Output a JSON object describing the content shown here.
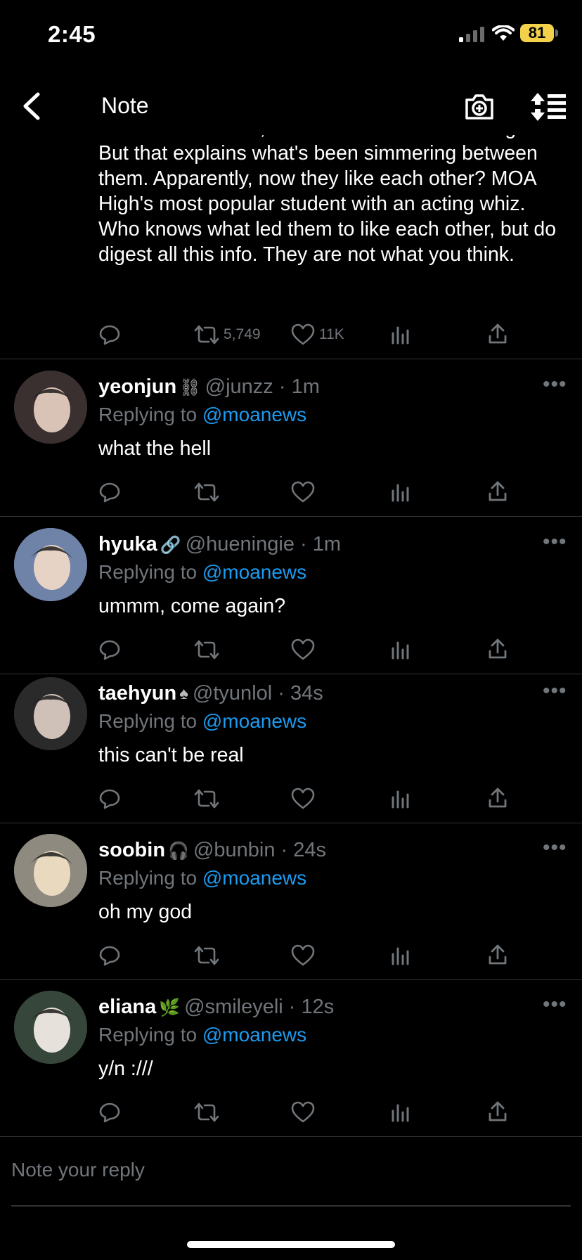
{
  "status": {
    "time": "2:45",
    "battery": "81"
  },
  "nav": {
    "title": "Note"
  },
  "main_tweet": {
    "text": "about this incident, and who wouldn't? This is gold! But that explains what's been simmering between them. Apparently, now they like each other? MOA High's most popular student with an acting whiz. Who knows what led them to like each other, but do digest all this info. They are not what you think.",
    "retweets": "5,749",
    "likes": "11K"
  },
  "replies": [
    {
      "name": "yeonjun",
      "badge": "⛓",
      "handle": "@junzz",
      "time": "1m",
      "replying_label": "Replying to",
      "replying_to": "@moanews",
      "text": "what the hell"
    },
    {
      "name": "hyuka",
      "badge": "🔗",
      "handle": "@hueningie",
      "time": "1m",
      "replying_label": "Replying to",
      "replying_to": "@moanews",
      "text": "ummm, come again?"
    },
    {
      "name": "taehyun",
      "badge": "♠",
      "handle": "@tyunlol",
      "time": "34s",
      "replying_label": "Replying to",
      "replying_to": "@moanews",
      "text": "this can't be real"
    },
    {
      "name": "soobin",
      "badge": "🎧",
      "handle": "@bunbin",
      "time": "24s",
      "replying_label": "Replying to",
      "replying_to": "@moanews",
      "text": "oh my god"
    },
    {
      "name": "eliana",
      "badge": "🌿",
      "handle": "@smileyeli",
      "time": "12s",
      "replying_label": "Replying to",
      "replying_to": "@moanews",
      "text": "y/n :///"
    }
  ],
  "composer": {
    "placeholder": "Note your reply"
  },
  "colors": {
    "accent": "#1d9bf0",
    "muted": "#71767b",
    "background": "#000000",
    "battery": "#f3d24a"
  }
}
